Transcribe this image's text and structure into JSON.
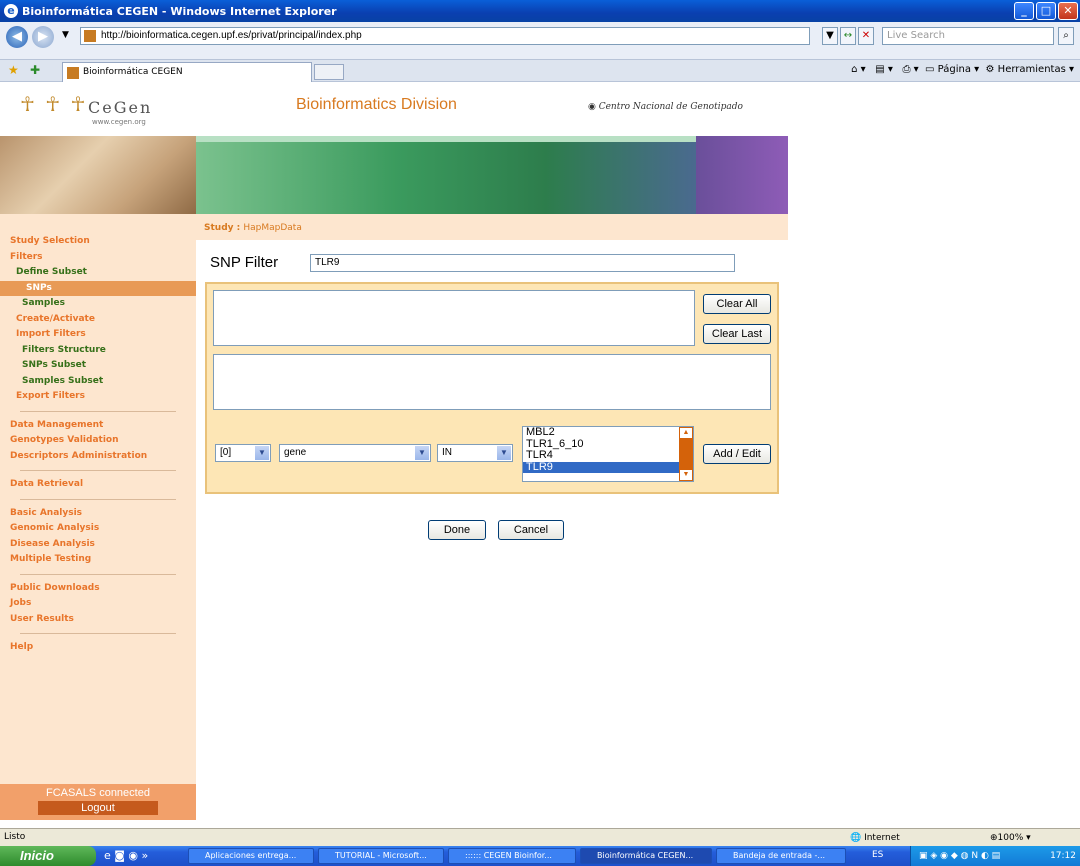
{
  "window": {
    "title": "Bioinformática CEGEN - Windows Internet Explorer"
  },
  "browser": {
    "url": "http://bioinformatica.cegen.upf.es/privat/principal/index.php",
    "search_placeholder": "Live Search",
    "tab_title": "Bioinformática CEGEN",
    "tools": {
      "page": "Página",
      "tools": "Herramientas"
    }
  },
  "header": {
    "logo": "CeGen",
    "logo_sub": "www.cegen.org",
    "division": "Bioinformatics Division",
    "centre": "Centro Nacional de Genotipado"
  },
  "sidebar": {
    "items": [
      {
        "label": "Study Selection",
        "level": 1
      },
      {
        "label": "Filters",
        "level": 1
      },
      {
        "label": "Define Subset",
        "level": 2
      },
      {
        "label": "SNPs",
        "level": 3,
        "active": true
      },
      {
        "label": "Samples",
        "level": 3
      },
      {
        "label": "Create/Activate",
        "level": 2
      },
      {
        "label": "Import Filters",
        "level": 2
      },
      {
        "label": "Filters Structure",
        "level": 3
      },
      {
        "label": "SNPs Subset",
        "level": 3
      },
      {
        "label": "Samples Subset",
        "level": 3
      },
      {
        "label": "Export Filters",
        "level": 2
      }
    ],
    "group2": [
      "Data Management",
      "Genotypes Validation",
      "Descriptors Administration"
    ],
    "group3": [
      "Data Retrieval"
    ],
    "group4": [
      "Basic Analysis",
      "Genomic Analysis",
      "Disease Analysis",
      "Multiple Testing"
    ],
    "group5": [
      "Public Downloads",
      "Jobs",
      "User Results"
    ],
    "group6": [
      "Help"
    ],
    "connected": "FCASALS connected",
    "logout": "Logout"
  },
  "study": {
    "label": "Study :",
    "value": "HapMapData"
  },
  "filter": {
    "title": "SNP Filter",
    "name_value": "TLR9",
    "clear_all": "Clear All",
    "clear_last": "Clear Last",
    "index_value": "[0]",
    "field_value": "gene",
    "operator_value": "IN",
    "list_options": [
      "MBL2",
      "TLR1_6_10",
      "TLR4",
      "TLR9"
    ],
    "list_selected": "TLR9",
    "add_edit": "Add / Edit",
    "done": "Done",
    "cancel": "Cancel"
  },
  "statusbar": {
    "text": "Listo",
    "zone": "Internet",
    "zoom": "100%"
  },
  "taskbar": {
    "start": "Inicio",
    "buttons": [
      "Aplicaciones entrega...",
      "TUTORIAL - Microsoft...",
      ":::::: CEGEN Bioinfor...",
      "Bioinformática CEGEN...",
      "Bandeja de entrada -..."
    ],
    "lang": "ES",
    "clock": "17:12"
  },
  "colors": {
    "accent": "#e8752b",
    "green": "#367019",
    "panel": "#fde6b5"
  }
}
